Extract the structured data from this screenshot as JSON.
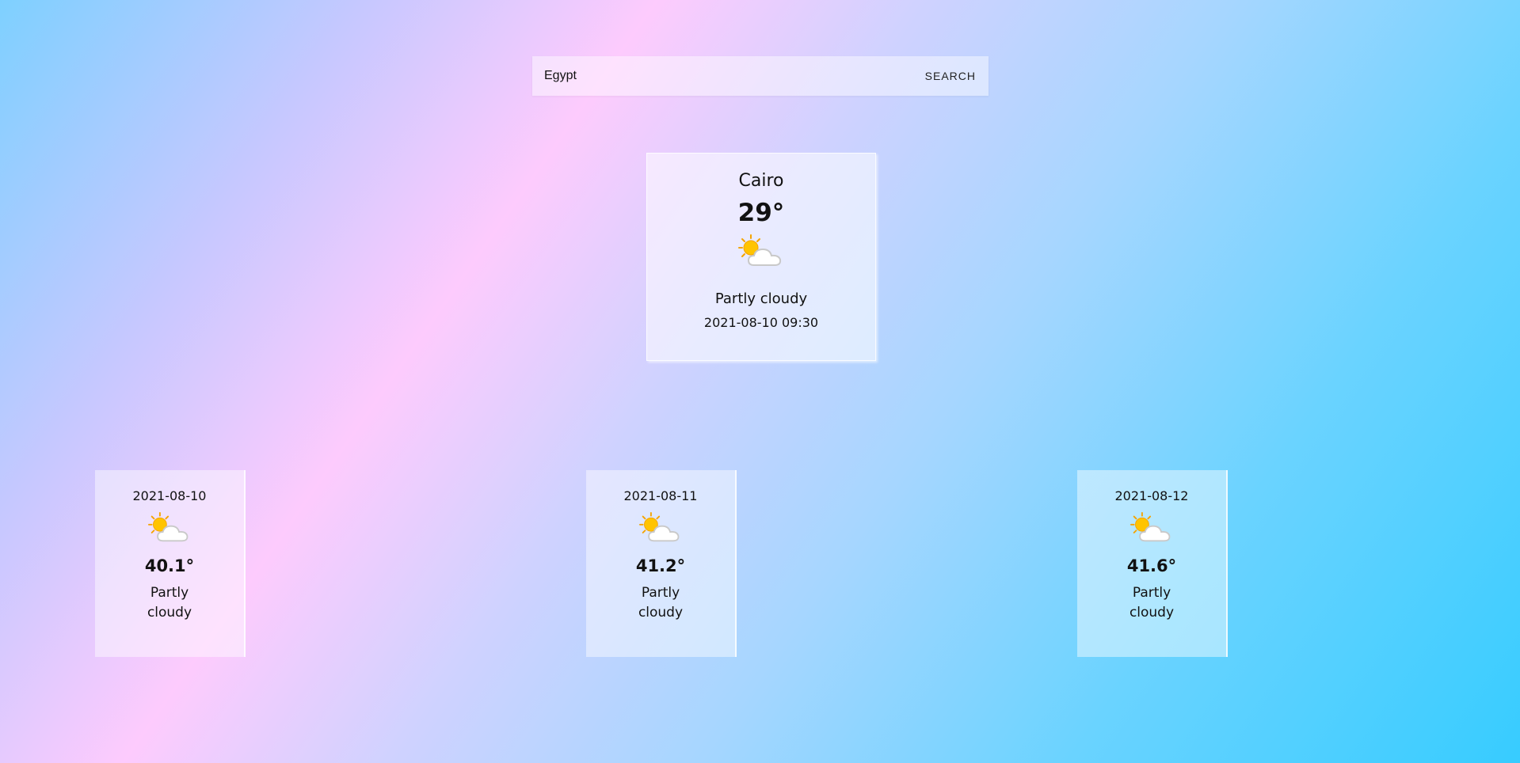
{
  "search": {
    "value": "Egypt",
    "button_label": "SEARCH"
  },
  "current": {
    "city": "Cairo",
    "temperature": "29°",
    "icon": "partly-cloudy-icon",
    "condition": "Partly cloudy",
    "datetime": "2021-08-10 09:30"
  },
  "forecast": [
    {
      "date": "2021-08-10",
      "icon": "partly-cloudy-icon",
      "temperature": "40.1°",
      "condition": "Partly cloudy"
    },
    {
      "date": "2021-08-11",
      "icon": "partly-cloudy-icon",
      "temperature": "41.2°",
      "condition": "Partly cloudy"
    },
    {
      "date": "2021-08-12",
      "icon": "partly-cloudy-icon",
      "temperature": "41.6°",
      "condition": "Partly cloudy"
    }
  ],
  "colors": {
    "sun": "#ffc400",
    "sun_rays": "#f5a300",
    "cloud": "#ffffff",
    "cloud_outline": "#c9c9c9"
  }
}
